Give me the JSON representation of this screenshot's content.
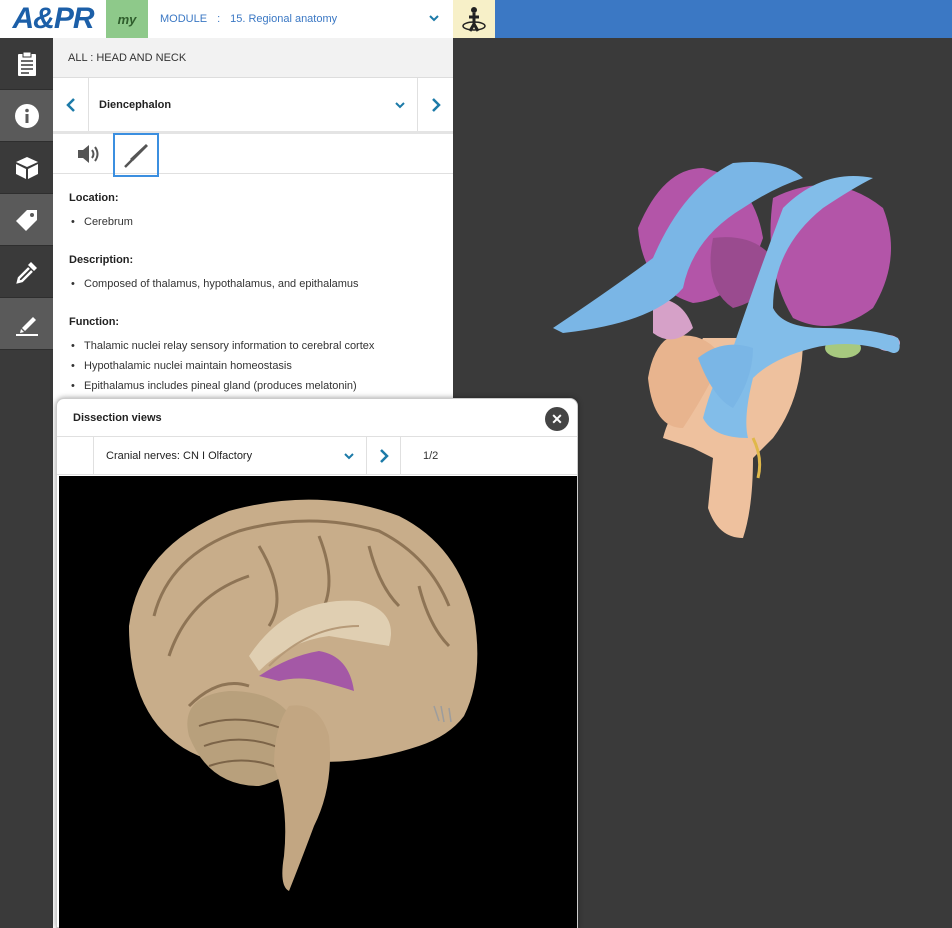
{
  "app": {
    "logo_text": "A&PR",
    "my_label": "my",
    "module_label": "MODULE",
    "module_separator": ":",
    "module_value": "15. Regional anatomy"
  },
  "rail": {
    "items": [
      {
        "icon": "clipboard-icon",
        "active": false
      },
      {
        "icon": "info-icon",
        "active": true
      },
      {
        "icon": "layers-cube-icon",
        "active": false
      },
      {
        "icon": "tag-icon",
        "active": true
      },
      {
        "icon": "eyedropper-icon",
        "active": false
      },
      {
        "icon": "highlighter-icon",
        "active": true
      }
    ]
  },
  "panel": {
    "breadcrumb": "ALL : HEAD AND NECK",
    "structure": "Diencephalon",
    "sections": [
      {
        "heading": "Location:",
        "items": [
          "Cerebrum"
        ]
      },
      {
        "heading": "Description:",
        "items": [
          "Composed of thalamus, hypothalamus, and epithalamus"
        ]
      },
      {
        "heading": "Function:",
        "items": [
          "Thalamic nuclei relay sensory information to cerebral cortex",
          "Hypothalamic nuclei maintain homeostasis",
          "Epithalamus includes pineal gland (produces melatonin)"
        ]
      }
    ]
  },
  "popup": {
    "title": "Dissection views",
    "close_label": "✕",
    "view_select": "Cranial nerves: CN I Olfactory",
    "pager": "1/2"
  },
  "colors": {
    "topbar": "#3b78c4",
    "accent": "#1c7aa8",
    "my_green": "#8ec98a",
    "figure_yellow": "#f7f0c8",
    "selected_border": "#3b8fe0"
  }
}
